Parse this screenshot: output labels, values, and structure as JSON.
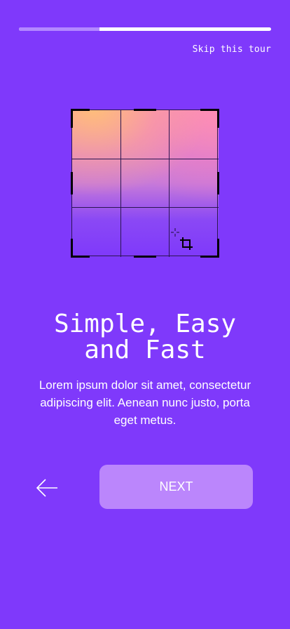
{
  "progress": {
    "fraction": 0.32
  },
  "header": {
    "skip_label": "Skip this tour"
  },
  "illustration": {
    "crop_icon": "crop-icon",
    "cursor_icon": "crosshair-cursor-icon"
  },
  "content": {
    "title": "Simple, Easy\nand Fast",
    "description": "Lorem ipsum dolor sit amet, consectetur adipiscing elit. Aenean nunc justo, porta eget metus."
  },
  "footer": {
    "back_icon": "arrow-left-icon",
    "next_label": "NEXT"
  },
  "colors": {
    "background": "#7f39fb",
    "progress_track": "#ffffff",
    "progress_fill": "#b388ff",
    "next_button": "#bb86fc"
  }
}
